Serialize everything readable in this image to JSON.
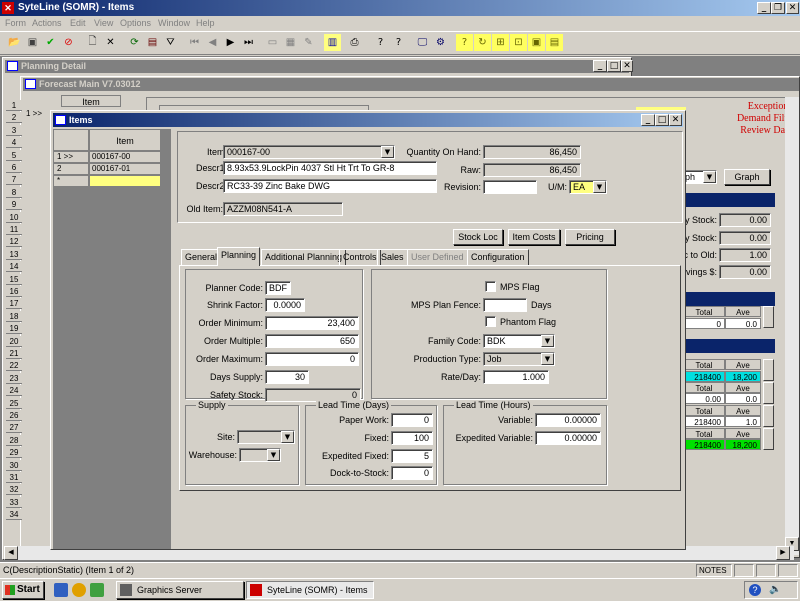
{
  "app": {
    "title": "SyteLine (SOMR) - Items"
  },
  "menu": [
    "Form",
    "Actions",
    "Edit",
    "View",
    "Options",
    "Window",
    "Help"
  ],
  "planning_detail": {
    "title": "Planning Detail"
  },
  "forecast": {
    "title": "Forecast Main V7.03012",
    "col_item": "Item",
    "row1": "1 >>",
    "ex1": "Exceptions:",
    "ex2": "Demand Filter",
    "ex3": "Review Date:",
    "graph_sel": "ph",
    "graph_btn": "Graph",
    "stock_labels": [
      "y Stock:",
      "y Stock:",
      "c to Old:",
      "avings $:"
    ],
    "stock_values": [
      "0.00",
      "0.00",
      "1.00",
      "0.00"
    ],
    "grid": {
      "total": "Total",
      "ave": "Ave",
      "r1": [
        "0",
        "0.0"
      ],
      "r2": [
        "218400",
        "18,200"
      ],
      "r3": [
        "0.00",
        "0.0"
      ],
      "r4": [
        "218400",
        "1.0"
      ],
      "r5": [
        "218400",
        "18,200"
      ]
    }
  },
  "row_numbers": [
    "1",
    "2",
    "3",
    "4",
    "5",
    "6",
    "7",
    "8",
    "9",
    "10",
    "11",
    "12",
    "13",
    "14",
    "15",
    "16",
    "17",
    "18",
    "19",
    "20",
    "21",
    "22",
    "23",
    "24",
    "25",
    "26",
    "27",
    "28",
    "29",
    "30",
    "31",
    "32",
    "33",
    "34"
  ],
  "items_window": {
    "title": "Items",
    "list": {
      "header": "Item",
      "rows": [
        {
          "marker": "1 >>",
          "item": "000167-00"
        },
        {
          "marker": "2",
          "item": "000167-01"
        },
        {
          "marker": "*",
          "item": ""
        }
      ]
    },
    "item_label": "Item:",
    "item_value": "000167-00",
    "descr1_label": "Descr1:",
    "descr1_value": "8.93x53.9LockPin 4037 Stl Ht Trt To GR-8",
    "descr2_label": "Descr2:",
    "descr2_value": "RC33-39 Zinc Bake DWG",
    "old_item_label": "Old Item:",
    "old_item_value": "AZZM08N541-A",
    "qoh_label": "Quantity On Hand:",
    "qoh_value": "86,450",
    "raw_label": "Raw:",
    "raw_value": "86,450",
    "revision_label": "Revision:",
    "revision_value": "",
    "um_label": "U/M:",
    "um_value": "EA",
    "buttons": {
      "stock_loc": "Stock Loc",
      "item_costs": "Item Costs",
      "pricing": "Pricing"
    },
    "tabs": [
      "General",
      "Planning",
      "Additional Planning",
      "Controls",
      "Sales",
      "User Defined",
      "Configuration"
    ],
    "planning": {
      "planner_code_label": "Planner Code:",
      "planner_code": "BDF",
      "shrink_label": "Shrink Factor:",
      "shrink": "0.0000",
      "order_min_label": "Order Minimum:",
      "order_min": "23,400",
      "order_mult_label": "Order Multiple:",
      "order_mult": "650",
      "order_max_label": "Order Maximum:",
      "order_max": "0",
      "days_supply_label": "Days Supply:",
      "days_supply": "30",
      "safety_label": "Safety Stock:",
      "safety": "0",
      "mps_flag_label": "MPS Flag",
      "mps_fence_label": "MPS Plan Fence:",
      "mps_fence": "",
      "days_label": "Days",
      "phantom_label": "Phantom Flag",
      "family_label": "Family Code:",
      "family": "BDK",
      "prod_type_label": "Production Type:",
      "prod_type": "Job",
      "rate_label": "Rate/Day:",
      "rate": "1.000",
      "supply_title": "Supply",
      "site_label": "Site:",
      "site": "",
      "warehouse_label": "Warehouse:",
      "warehouse": "",
      "lt_days_title": "Lead Time (Days)",
      "paper_label": "Paper Work:",
      "paper": "0",
      "fixed_label": "Fixed:",
      "fixed": "100",
      "exp_fixed_label": "Expedited Fixed:",
      "exp_fixed": "5",
      "dock_label": "Dock-to-Stock:",
      "dock": "0",
      "lt_hours_title": "Lead Time (Hours)",
      "variable_label": "Variable:",
      "variable": "0.00000",
      "exp_var_label": "Expedited Variable:",
      "exp_var": "0.00000"
    }
  },
  "status": {
    "text": "C(DescriptionStatic) (Item 1 of 2)",
    "notes": "NOTES"
  },
  "taskbar": {
    "start": "Start",
    "tasks": [
      "Graphics Server",
      "SyteLine (SOMR) - Items"
    ]
  }
}
